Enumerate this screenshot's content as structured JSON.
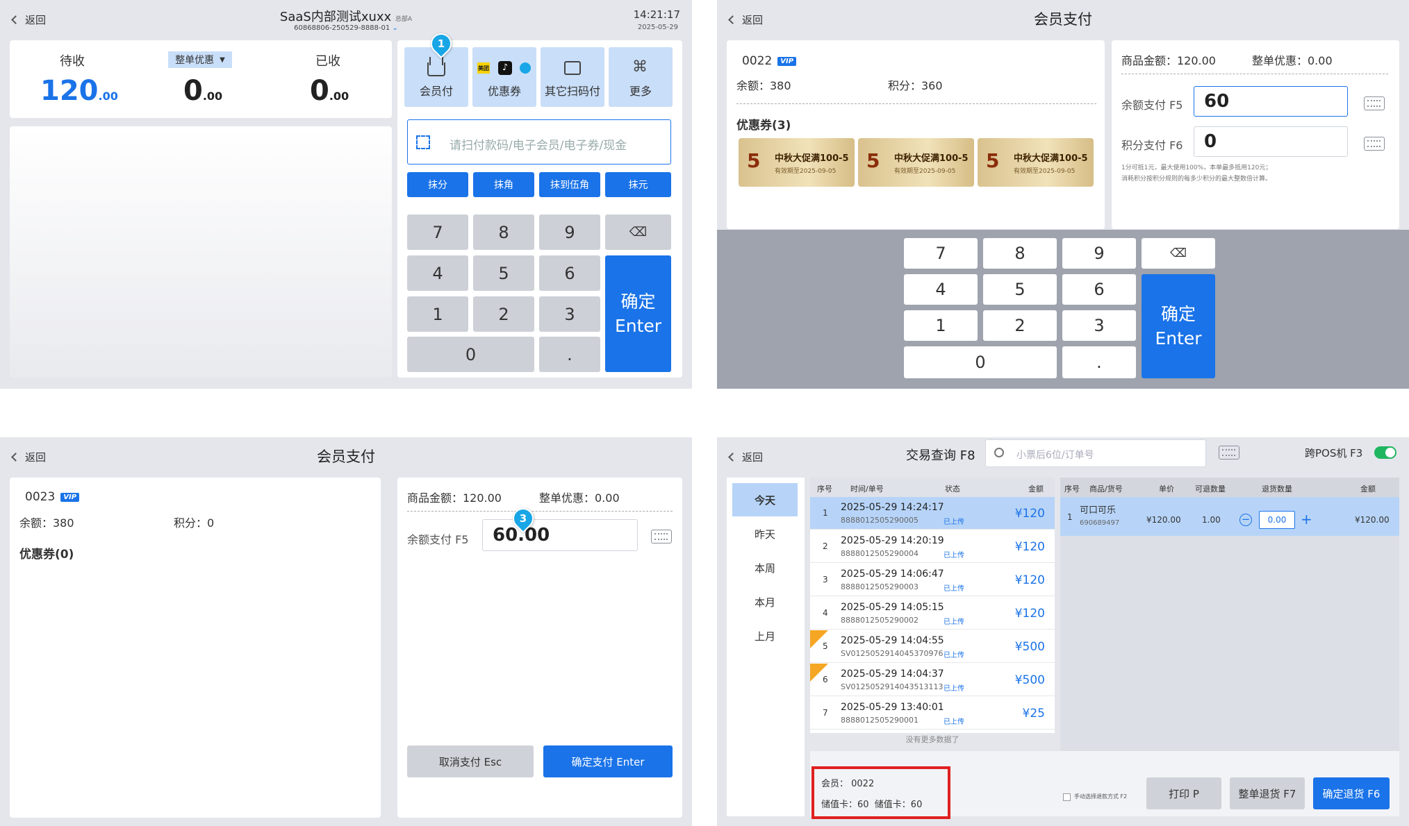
{
  "p1": {
    "back": "返回",
    "title": "SaaS内部测试xuxx",
    "store": "总部A",
    "sub": "60868806-250529-8888-01",
    "time": "14:21:17",
    "date": "2025-05-29",
    "recv_label": "待收",
    "recv_big": "120",
    "recv_small": ".00",
    "disc_label": "整单优惠",
    "disc_big": "0",
    "disc_small": ".00",
    "paid_label": "已收",
    "paid_big": "0",
    "paid_small": ".00",
    "tiles": [
      "会员付",
      "优惠券",
      "其它扫码付",
      "更多"
    ],
    "meituan": "美团",
    "input_ph": "请扫付款码/电子会员/电子券/现金",
    "round_btns": [
      "抹分",
      "抹角",
      "抹到伍角",
      "抹元"
    ],
    "keys": [
      "7",
      "8",
      "9",
      "4",
      "5",
      "6",
      "1",
      "2",
      "3",
      "0",
      "."
    ],
    "ok1": "确定",
    "ok2": "Enter",
    "pin": "1"
  },
  "p2": {
    "title": "会员支付",
    "member": "0022",
    "vip": "VIP",
    "bal": "余额：380",
    "pts": "积分：360",
    "coupons_title": "优惠券(3)",
    "coupons": [
      {
        "v": "5",
        "t": "中秋大促满100-5",
        "d": "有效期至2025-09-05"
      },
      {
        "v": "5",
        "t": "中秋大促满100-5",
        "d": "有效期至2025-09-05"
      },
      {
        "v": "5",
        "t": "中秋大促满100-5",
        "d": "有效期至2025-09-05"
      }
    ],
    "amount": "商品金额：120.00",
    "disc": "整单优惠：0.00",
    "bal_pay_label": "余额支付 F5",
    "bal_pay_val": "60",
    "pts_pay_label": "积分支付 F6",
    "pts_pay_val": "0",
    "note1": "1分可抵1元，最大使用100%，本单最多抵用120元；",
    "note2": "消耗积分按积分规则的每多少积分的最大整数倍计算。",
    "pin": "2",
    "keys": [
      "7",
      "8",
      "9",
      "4",
      "5",
      "6",
      "1",
      "2",
      "3",
      "0",
      "."
    ],
    "ok1": "确定",
    "ok2": "Enter"
  },
  "p3": {
    "back": "返回",
    "title": "会员支付",
    "member": "0023",
    "vip": "VIP",
    "bal": "余额：380",
    "pts": "积分：0",
    "coupons_title": "优惠券(0)",
    "amount": "商品金额：120.00",
    "disc": "整单优惠：0.00",
    "bal_pay_label": "余额支付 F5",
    "bal_pay_val": "60.00",
    "pin": "3",
    "cancel": "取消支付 Esc",
    "confirm": "确定支付 Enter"
  },
  "p4": {
    "back": "返回",
    "title": "交易查询 F8",
    "search_ph": "小票后6位/订单号",
    "cross": "跨POS机 F3",
    "days": [
      "今天",
      "昨天",
      "本周",
      "本月",
      "上月"
    ],
    "th_left": [
      "序号",
      "时间/单号",
      "状态",
      "金额"
    ],
    "rows": [
      {
        "no": "1",
        "tm": "2025-05-29 14:24:17",
        "id": "8888012505290005",
        "st": "已上传",
        "amt": "¥120"
      },
      {
        "no": "2",
        "tm": "2025-05-29 14:20:19",
        "id": "8888012505290004",
        "st": "已上传",
        "amt": "¥120"
      },
      {
        "no": "3",
        "tm": "2025-05-29 14:06:47",
        "id": "8888012505290003",
        "st": "已上传",
        "amt": "¥120"
      },
      {
        "no": "4",
        "tm": "2025-05-29 14:05:15",
        "id": "8888012505290002",
        "st": "已上传",
        "amt": "¥120"
      },
      {
        "no": "5",
        "tm": "2025-05-29 14:04:55",
        "id": "SV0125052914045370976",
        "st": "已上传",
        "amt": "¥500"
      },
      {
        "no": "6",
        "tm": "2025-05-29 14:04:37",
        "id": "SV0125052914043513113",
        "st": "已上传",
        "amt": "¥500"
      },
      {
        "no": "7",
        "tm": "2025-05-29 13:40:01",
        "id": "8888012505290001",
        "st": "已上传",
        "amt": "¥25"
      }
    ],
    "nomore": "没有更多数据了",
    "th_right": [
      "序号",
      "商品/货号",
      "单价",
      "可退数量",
      "退货数量",
      "金额"
    ],
    "item": {
      "no": "1",
      "name": "可口可乐",
      "code": "690689497",
      "price": "¥120.00",
      "qty": "1.00",
      "ret": "0.00",
      "amt": "¥120.00"
    },
    "mem": "会员： 0022",
    "cards": "储值卡：60  储值卡：60",
    "manual": "手动选择退款方式 F2",
    "print": "打印 P",
    "full_return": "整单退货 F7",
    "confirm_return": "确定退货 F6"
  },
  "colors": {
    "accent": "#1a73e8",
    "highlight": "#e02020",
    "pin": "#19a6e6"
  }
}
